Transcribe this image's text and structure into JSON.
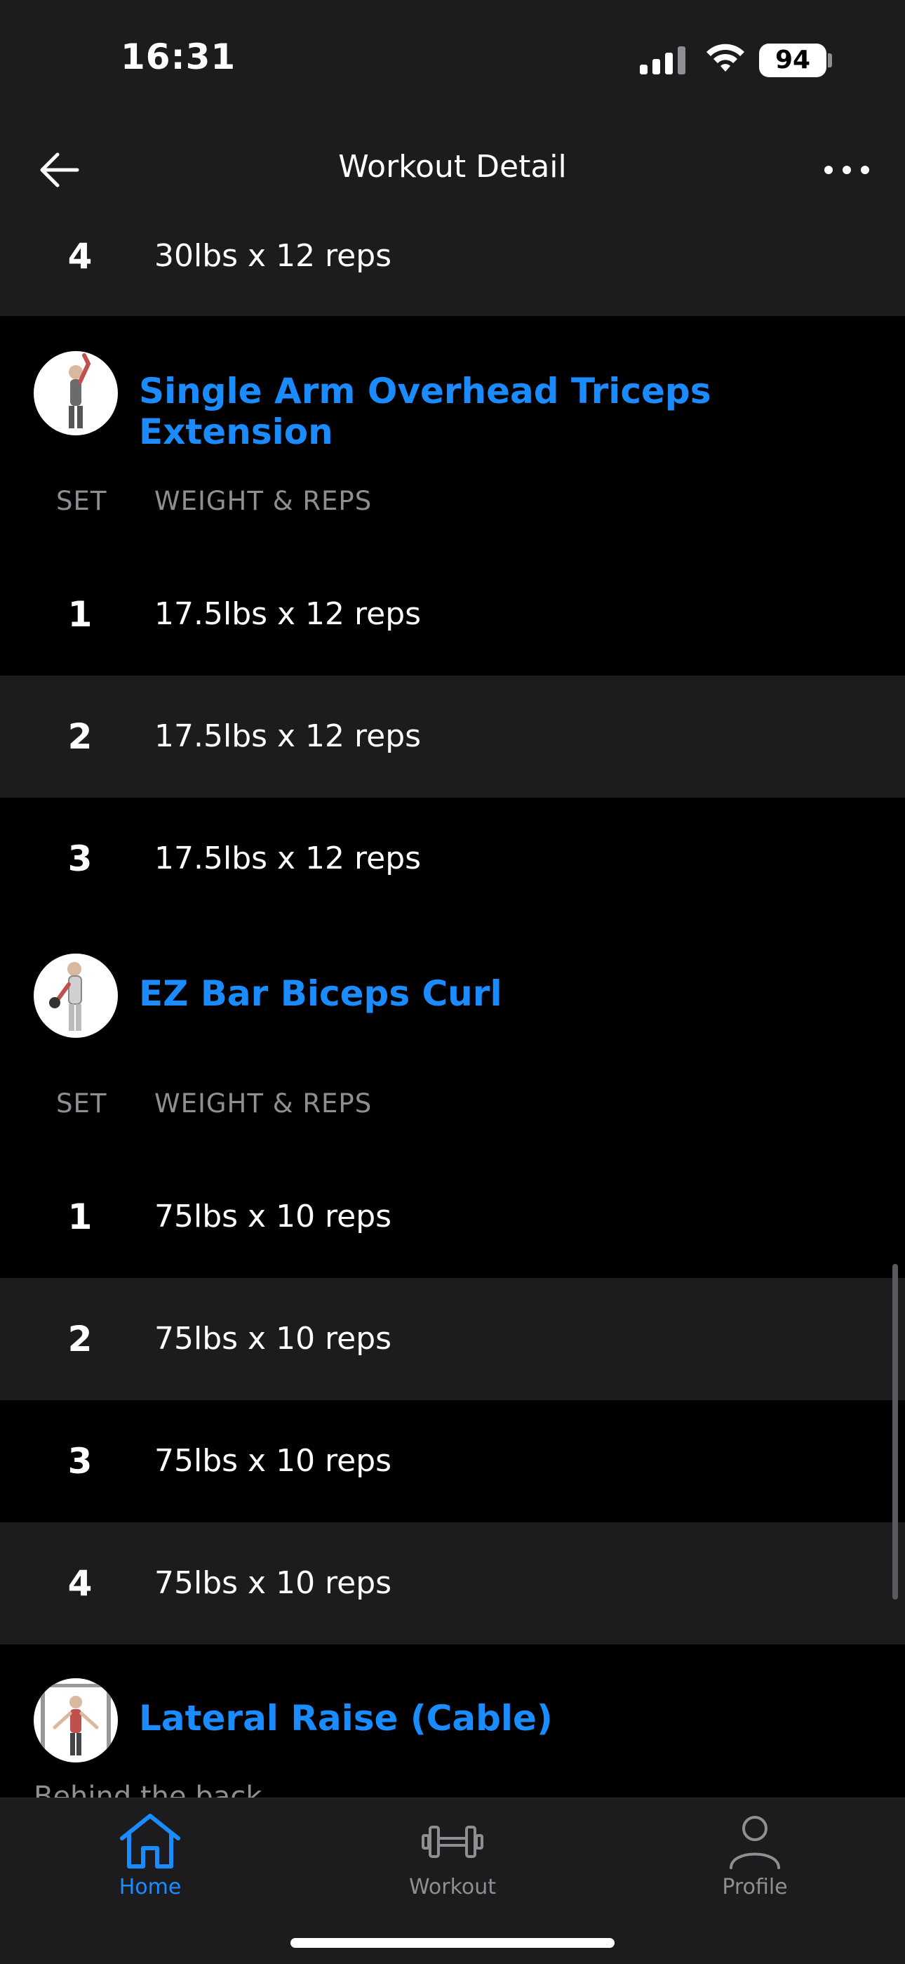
{
  "status": {
    "time": "16:31",
    "battery": "94"
  },
  "nav": {
    "title": "Workout Detail"
  },
  "prev_row": {
    "set": "4",
    "value": "30lbs x 12 reps"
  },
  "exercises": [
    {
      "title": "Single Arm Overhead Triceps Extension",
      "col_set": "SET",
      "col_wr": "WEIGHT & REPS",
      "sets": [
        {
          "set": "1",
          "value": "17.5lbs x 12 reps"
        },
        {
          "set": "2",
          "value": "17.5lbs x 12 reps"
        },
        {
          "set": "3",
          "value": "17.5lbs x 12 reps"
        }
      ]
    },
    {
      "title": "EZ Bar Biceps Curl",
      "col_set": "SET",
      "col_wr": "WEIGHT & REPS",
      "sets": [
        {
          "set": "1",
          "value": "75lbs x 10 reps"
        },
        {
          "set": "2",
          "value": "75lbs x 10 reps"
        },
        {
          "set": "3",
          "value": "75lbs x 10 reps"
        },
        {
          "set": "4",
          "value": "75lbs x 10 reps"
        }
      ]
    },
    {
      "title": "Lateral Raise (Cable)",
      "partial_note": "Behind the back"
    }
  ],
  "tabs": [
    {
      "label": "Home",
      "icon": "home-icon",
      "active": true
    },
    {
      "label": "Workout",
      "icon": "dumbbell-icon",
      "active": false
    },
    {
      "label": "Profile",
      "icon": "person-icon",
      "active": false
    }
  ],
  "colors": {
    "accent": "#1a8cff",
    "bg": "#000000",
    "alt_row": "#1c1c1e",
    "muted": "#8e8e93"
  }
}
